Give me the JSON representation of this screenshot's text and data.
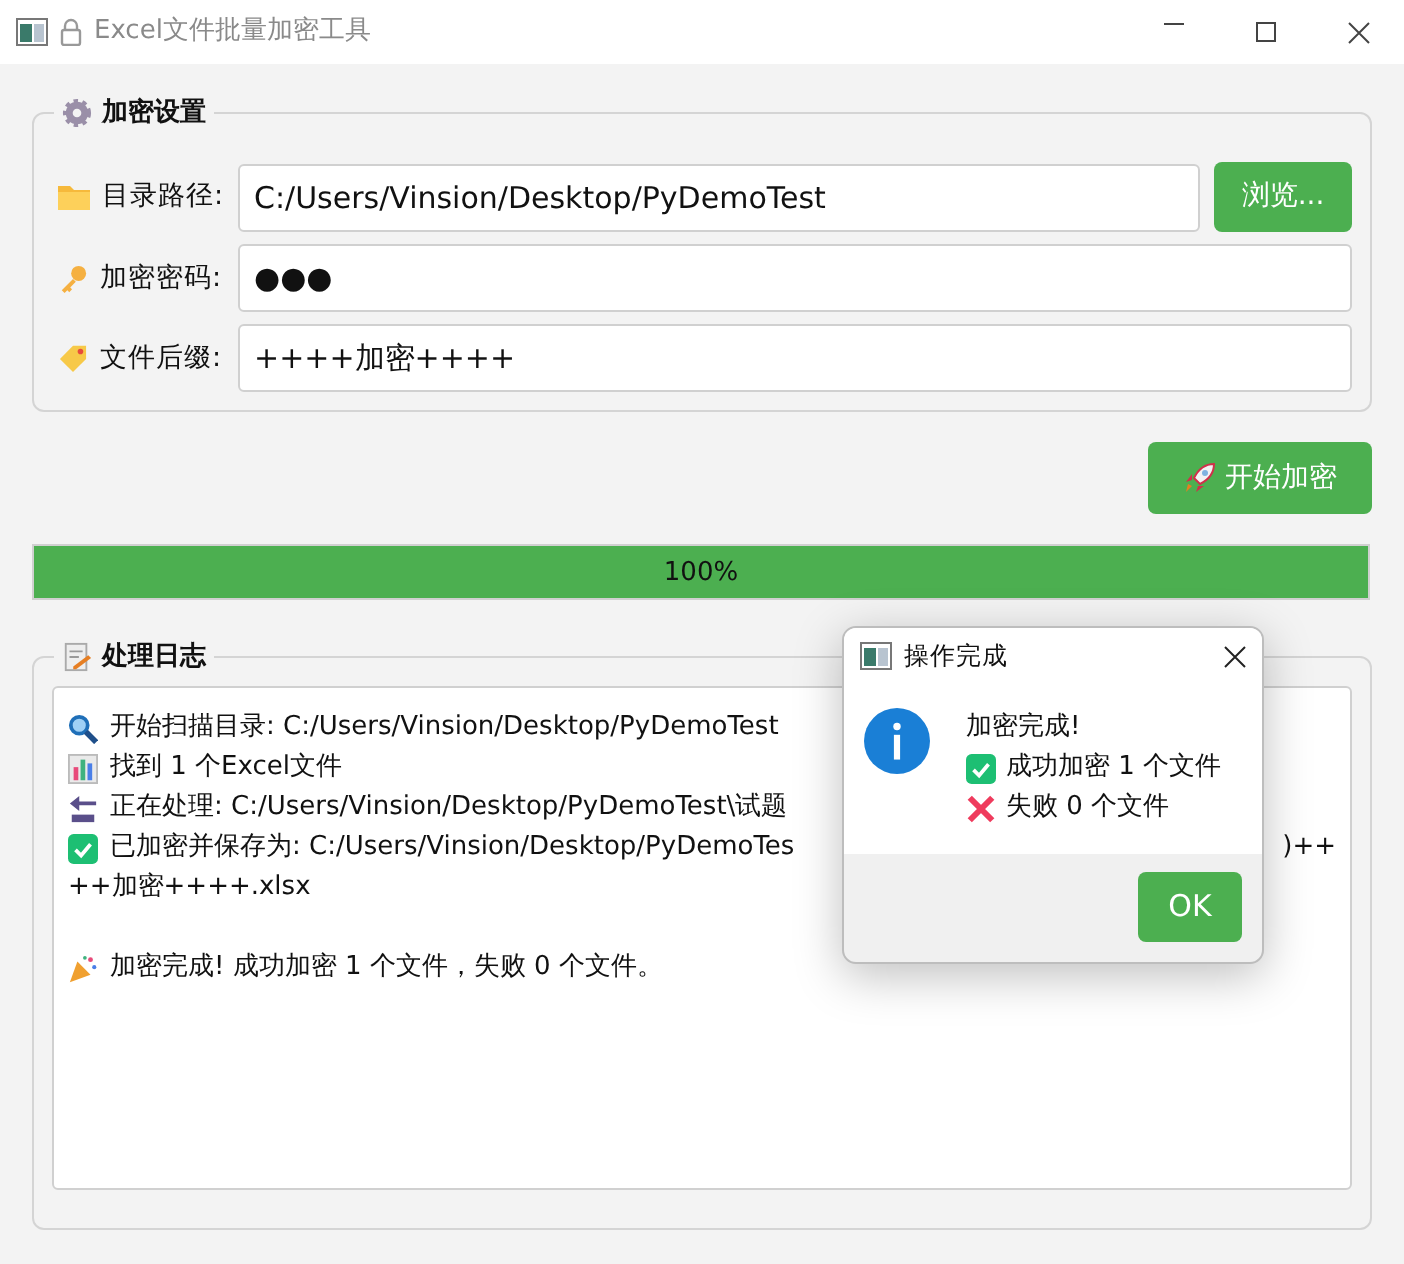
{
  "window": {
    "title": "Excel文件批量加密工具"
  },
  "settings": {
    "title": "加密设置",
    "fields": [
      {
        "kind": "folder",
        "label": "目录路径:",
        "value": "C:/Users/Vinsion/Desktop/PyDemoTest"
      },
      {
        "kind": "key",
        "label": "加密密码:",
        "value": "●●●"
      },
      {
        "kind": "tag",
        "label": "文件后缀:",
        "value": "++++加密++++"
      }
    ],
    "browse_button": "浏览..."
  },
  "start_button": "开始加密",
  "progress": {
    "level": 1,
    "text": "100%"
  },
  "log": {
    "title": "处理日志",
    "lines": [
      {
        "kind": "search",
        "text": "开始扫描目录: C:/Users/Vinsion/Desktop/PyDemoTest"
      },
      {
        "kind": "chart",
        "text": "找到 1 个Excel文件"
      },
      {
        "kind": "back",
        "text": "正在处理: C:/Users/Vinsion/Desktop/PyDemoTest\\试题"
      },
      {
        "kind": "check",
        "text": "已加密并保存为: C:/Users/Vinsion/Desktop/PyDemoTes",
        "tail": ")++"
      },
      {
        "text": "++加密++++.xlsx"
      },
      {
        "kind": "party",
        "text": "加密完成! 成功加密 1 个文件，失败 0 个文件。",
        "gap_before": true
      }
    ]
  },
  "dialog": {
    "title": "操作完成",
    "lines": [
      {
        "text": "加密完成!"
      },
      {
        "kind": "check",
        "text": "成功加密 1 个文件"
      },
      {
        "kind": "cross",
        "text": "失败 0 个文件"
      }
    ],
    "button": "OK"
  }
}
